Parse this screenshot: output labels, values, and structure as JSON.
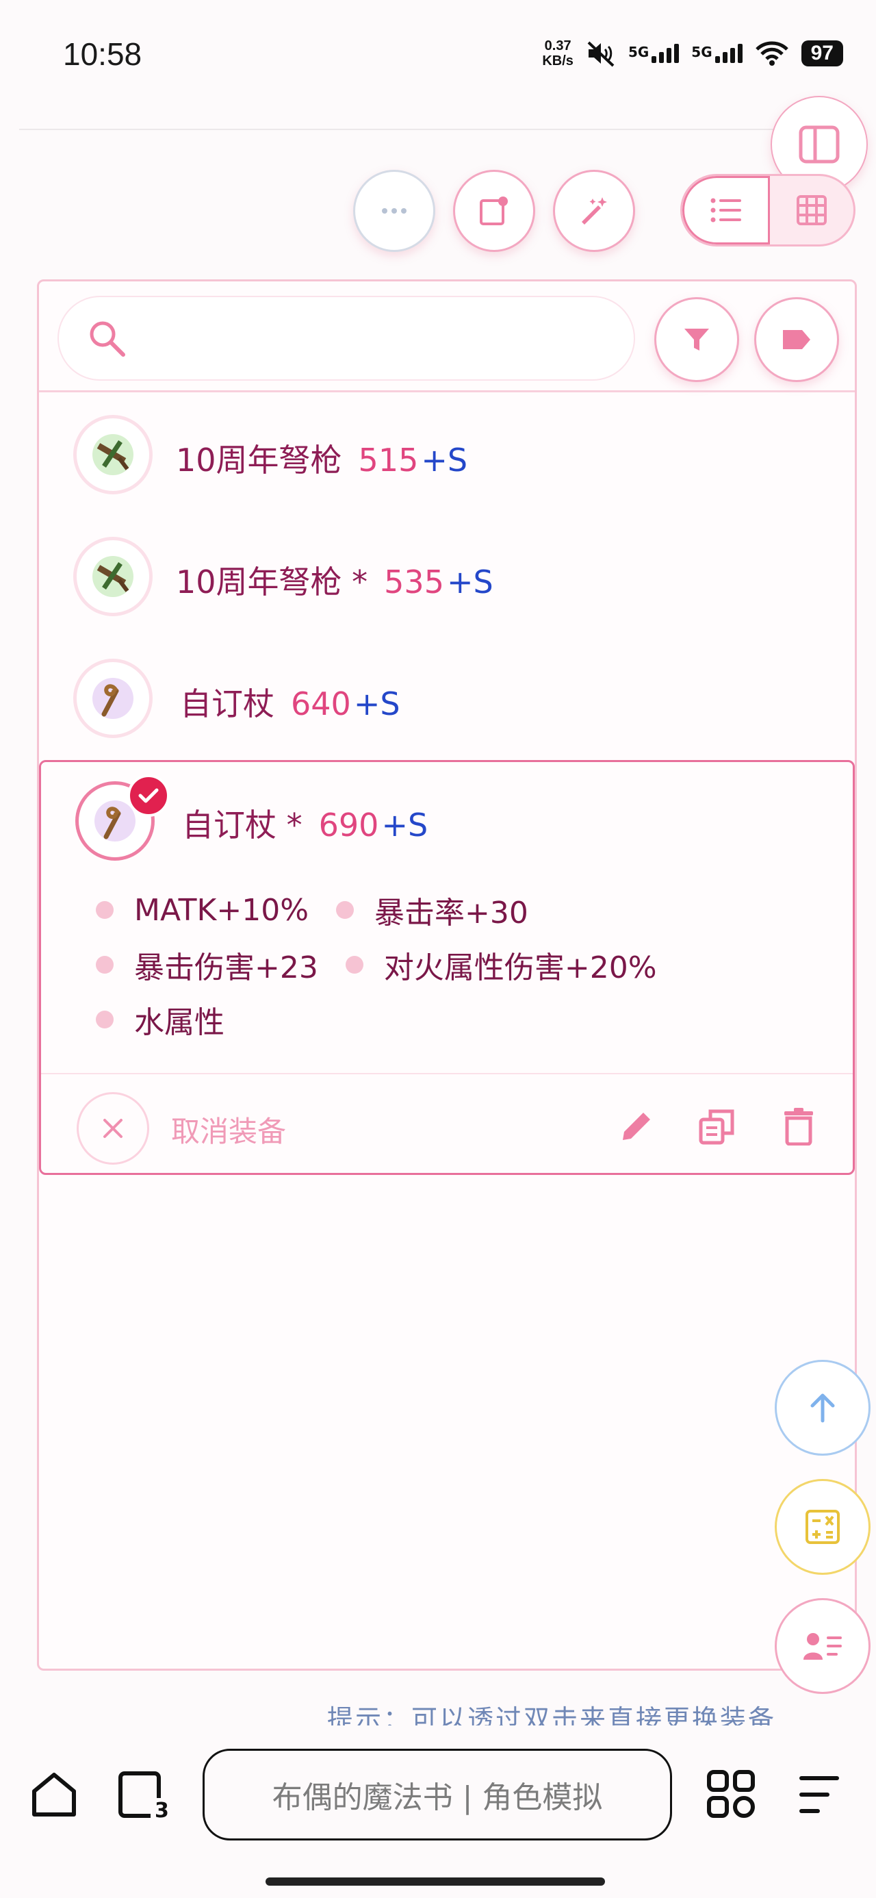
{
  "status": {
    "time": "10:58",
    "net_speed_value": "0.37",
    "net_speed_unit": "KB/s",
    "signal1_label": "5G",
    "signal2_label": "5G",
    "battery": "97"
  },
  "toolbar": {
    "icons": [
      "more-icon",
      "note-icon",
      "magic-wand-icon",
      "list-view-icon",
      "grid-view-icon",
      "sidebar-toggle-icon"
    ]
  },
  "search": {
    "value": "",
    "placeholder": ""
  },
  "items": [
    {
      "name": "10周年弩枪",
      "value": "515",
      "plus": "+S",
      "icon": "crossbow-icon"
    },
    {
      "name": "10周年弩枪 *",
      "value": "535",
      "plus": "+S",
      "icon": "crossbow-icon"
    },
    {
      "name": "自订杖",
      "value": "640",
      "plus": "+S",
      "icon": "staff-icon"
    }
  ],
  "selected": {
    "name": "自订杖 *",
    "value": "690",
    "plus": "+S",
    "icon": "staff-icon",
    "attrs": [
      "MATK+10%",
      "暴击率+30",
      "暴击伤害+23",
      "对火属性伤害+20%",
      "水属性"
    ],
    "cancel_label": "取消装备"
  },
  "hint": "提示：可以透过双击来直接更换装备",
  "browser": {
    "url_text": "布偶的魔法书 | 角色模拟"
  },
  "colors": {
    "accent": "#e8709b",
    "item_name": "#8e1d55",
    "value": "#e0457f",
    "plus": "#2447c9",
    "check": "#e1214f"
  }
}
